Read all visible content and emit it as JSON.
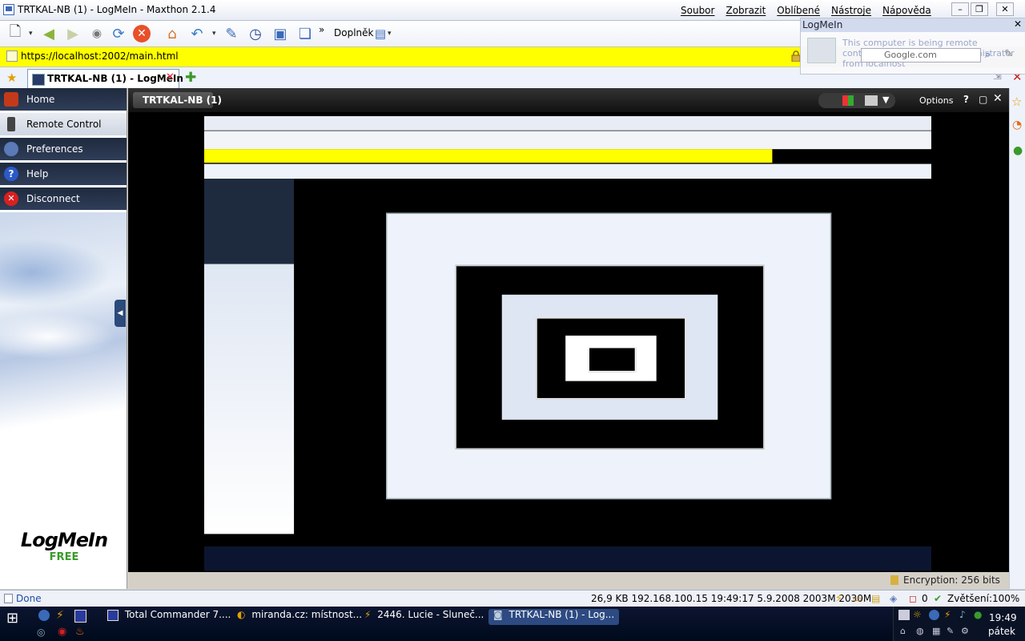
{
  "window": {
    "title": "TRTKAL-NB (1) - LogMeIn - Maxthon 2.1.4",
    "menu": [
      "Soubor",
      "Zobrazit",
      "Oblíbené",
      "Nástroje",
      "Nápověda"
    ]
  },
  "toolbar": {
    "addons_label": "Doplněk",
    "more_label": "»"
  },
  "address": {
    "url": "https://localhost:2002/main.html"
  },
  "tabs": [
    {
      "title": "TRTKAL-NB (1) - LogMeIn"
    }
  ],
  "popup": {
    "title": "LogMeIn",
    "message": "This computer is being remote controlled by TRTKAL-NB\\Administrator from localhost",
    "search_placeholder": "Google.com"
  },
  "sidebar": {
    "items": [
      {
        "label": "Home",
        "icon": "home-icon"
      },
      {
        "label": "Remote Control",
        "icon": "remote-control-icon"
      },
      {
        "label": "Preferences",
        "icon": "preferences-icon"
      },
      {
        "label": "Help",
        "icon": "help-icon"
      },
      {
        "label": "Disconnect",
        "icon": "disconnect-icon"
      }
    ],
    "logo_text": "LogMeIn",
    "logo_sub": "FREE"
  },
  "main": {
    "title": "TRTKAL-NB (1)",
    "options_label": "Options",
    "help_label": "?",
    "encryption": "Encryption: 256 bits"
  },
  "status": {
    "done": "Done",
    "info": "26,9 KB   192.168.100.15   19:49:17 5.9.2008 2003M 2030M",
    "count": "0",
    "zoom": "Zvětšení:100%"
  },
  "taskbar": {
    "tasks": [
      {
        "label": "Total Commander 7...."
      },
      {
        "label": "miranda.cz: místnost..."
      },
      {
        "label": "2446. Lucie - Sluneč..."
      },
      {
        "label": "TRTKAL-NB (1) - Log..."
      }
    ],
    "time": "19:49",
    "day": "pátek"
  },
  "colors": {
    "address_bar": "#ffff00",
    "sidebar_nav": "#1e2a3e",
    "active_task": "#2d4a82",
    "free_green": "#3a9a2a"
  }
}
